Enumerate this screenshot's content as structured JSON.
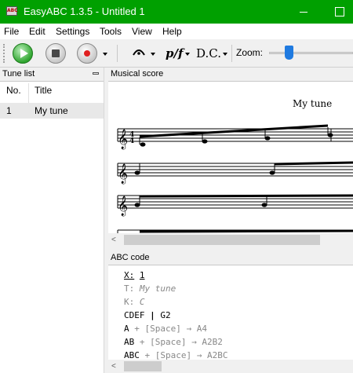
{
  "window": {
    "title": "EasyABC 1.3.5 - Untitled 1"
  },
  "menu": [
    "File",
    "Edit",
    "Settings",
    "Tools",
    "View",
    "Help"
  ],
  "toolbar": {
    "dynamics_label": "p/f",
    "dc_label": "D.C.",
    "zoom_label": "Zoom:",
    "zoom_level": 0.2
  },
  "tune_list": {
    "header": "Tune list",
    "columns": [
      "No.",
      "Title"
    ],
    "rows": [
      {
        "no": "1",
        "title": "My tune"
      }
    ]
  },
  "score": {
    "header": "Musical score",
    "title": "My tune"
  },
  "abc": {
    "header": "ABC code",
    "lines": {
      "x_key": "X:",
      "x_val": "1",
      "t_key": "T:",
      "t_val": "My tune",
      "k_key": "K:",
      "k_val": "C",
      "l4_a": "CDEF",
      "l4_b": "|",
      "l4_c": "G2",
      "l5_a": "A",
      "l5_b": "+ [Space] →",
      "l5_c": "A4",
      "l6_a": "AB",
      "l6_b": "+ [Space] →",
      "l6_c": "A2B2",
      "l7_a": "ABC",
      "l7_b": "+ [Space] →",
      "l7_c": "A2BC"
    }
  },
  "colors": {
    "titlebar": "#00a000",
    "zoom_thumb": "#1f7ae0",
    "record": "#e02020"
  }
}
